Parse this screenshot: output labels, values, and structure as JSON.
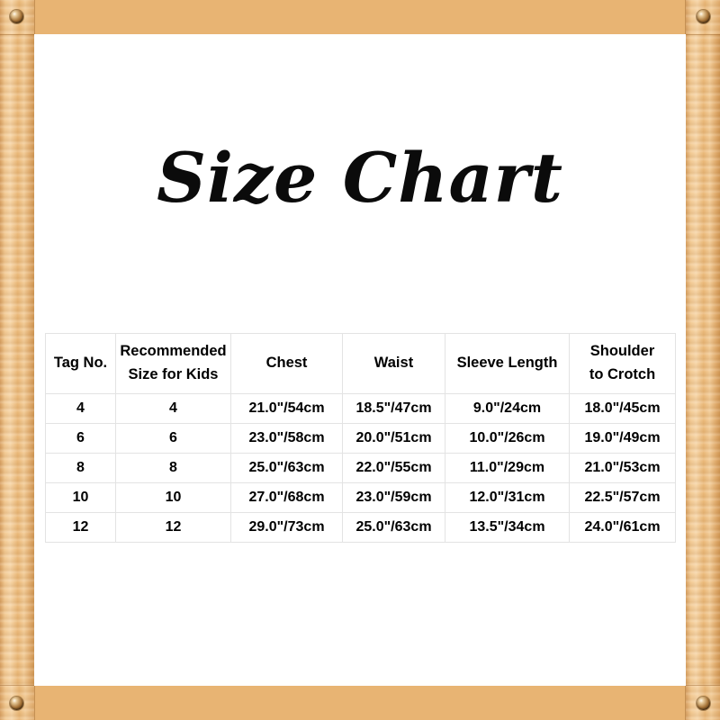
{
  "frame": {
    "material": "wood",
    "wood_color": "#e8b473",
    "screw_color": "#6b4519",
    "screws": [
      {
        "name": "screw-top-left"
      },
      {
        "name": "screw-top-right"
      },
      {
        "name": "screw-bottom-left"
      },
      {
        "name": "screw-bottom-right"
      }
    ]
  },
  "title": "Size Chart",
  "table": {
    "headers": [
      "Tag No.",
      "Recommended Size for Kids",
      "Chest",
      "Waist",
      "Sleeve Length",
      "Shoulder to Crotch"
    ],
    "header_lines": [
      [
        "Tag No."
      ],
      [
        "Recommended",
        "Size for Kids"
      ],
      [
        "Chest"
      ],
      [
        "Waist"
      ],
      [
        "Sleeve Length"
      ],
      [
        "Shoulder",
        "to Crotch"
      ]
    ],
    "rows": [
      {
        "tag_no": "4",
        "recommended_size": "4",
        "chest": "21.0\"/54cm",
        "waist": "18.5\"/47cm",
        "sleeve_length": "9.0\"/24cm",
        "shoulder_to_crotch": "18.0\"/45cm"
      },
      {
        "tag_no": "6",
        "recommended_size": "6",
        "chest": "23.0\"/58cm",
        "waist": "20.0\"/51cm",
        "sleeve_length": "10.0\"/26cm",
        "shoulder_to_crotch": "19.0\"/49cm"
      },
      {
        "tag_no": "8",
        "recommended_size": "8",
        "chest": "25.0\"/63cm",
        "waist": "22.0\"/55cm",
        "sleeve_length": "11.0\"/29cm",
        "shoulder_to_crotch": "21.0\"/53cm"
      },
      {
        "tag_no": "10",
        "recommended_size": "10",
        "chest": "27.0\"/68cm",
        "waist": "23.0\"/59cm",
        "sleeve_length": "12.0\"/31cm",
        "shoulder_to_crotch": "22.5\"/57cm"
      },
      {
        "tag_no": "12",
        "recommended_size": "12",
        "chest": "29.0\"/73cm",
        "waist": "25.0\"/63cm",
        "sleeve_length": "13.5\"/34cm",
        "shoulder_to_crotch": "24.0\"/61cm"
      }
    ]
  },
  "colors": {
    "background": "#ffffff",
    "text": "#000000",
    "table_border": "#e3e3e3",
    "frame_wood": "#e8b473"
  }
}
